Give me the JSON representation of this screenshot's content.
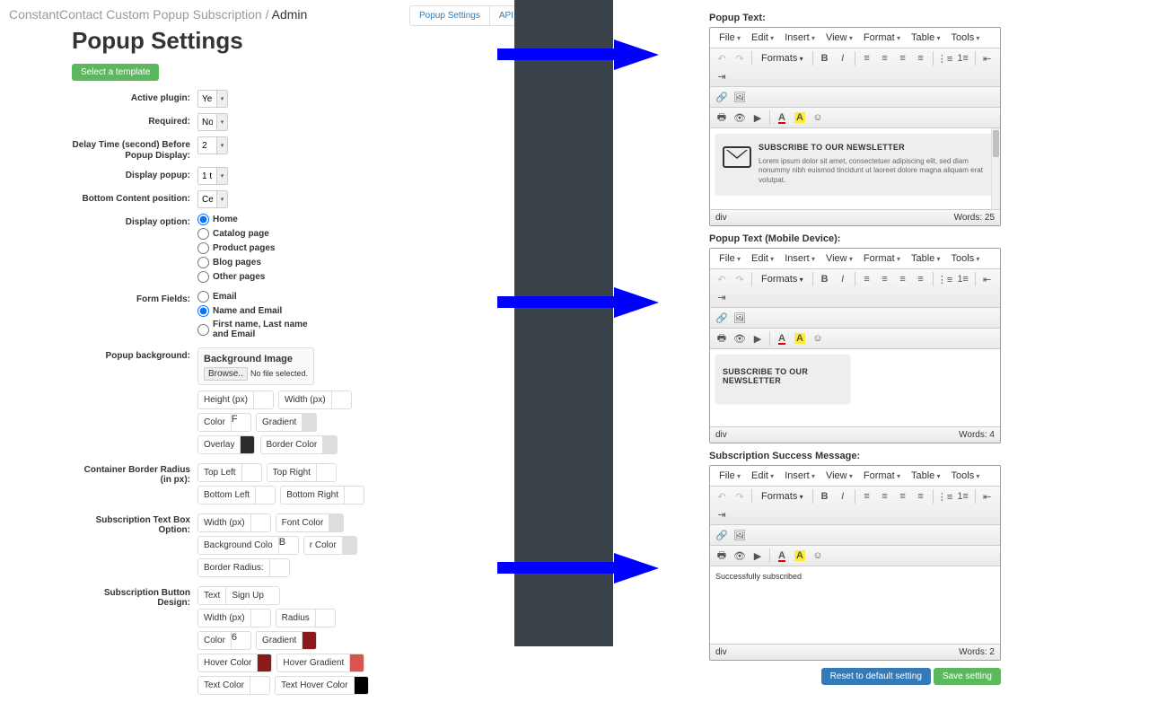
{
  "breadcrumb": {
    "app": "ConstantContact Custom Popup Subscription",
    "sep": " / ",
    "page": "Admin"
  },
  "tabs": {
    "popup": "Popup Settings",
    "api": "API Settings"
  },
  "title": "Popup Settings",
  "select_template": "Select a template",
  "form": {
    "active_plugin": {
      "label": "Active plugin:",
      "value": "Ye"
    },
    "required": {
      "label": "Required:",
      "value": "No"
    },
    "delay": {
      "label": "Delay Time (second) Before Popup Display:",
      "value": "2"
    },
    "display_popup": {
      "label": "Display popup:",
      "value": "1 t"
    },
    "bottom_content": {
      "label": "Bottom Content position:",
      "value": "Ce"
    },
    "display_option": {
      "label": "Display option:",
      "items": [
        "Home",
        "Catalog page",
        "Product pages",
        "Blog pages",
        "Other pages"
      ],
      "selected": 0
    },
    "form_fields": {
      "label": "Form Fields:",
      "items": [
        "Email",
        "Name and Email",
        "First name, Last name and Email"
      ],
      "selected": 1
    },
    "popup_bg": {
      "label": "Popup background:",
      "panel_title": "Background Image",
      "browse": "Browse..",
      "no_file": "No file selected.",
      "height": "Height (px)",
      "width": "Width (px)",
      "color": "Color",
      "color_v": "F",
      "gradient": "Gradient",
      "overlay": "Overlay",
      "border_color": "Border Color"
    },
    "border_radius": {
      "label": "Container Border Radius (in px):",
      "tl": "Top Left",
      "tr": "Top Right",
      "bl": "Bottom Left",
      "br": "Bottom Right"
    },
    "textbox": {
      "label": "Subscription Text Box Option:",
      "width": "Width (px)",
      "font_color": "Font Color",
      "bg": "Background Colo",
      "bg_v": "B",
      "bc": "r Color",
      "br": "Border Radius:"
    },
    "button": {
      "label": "Subscription Button Design:",
      "text": "Text",
      "text_v": "Sign Up",
      "width": "Width (px)",
      "radius": "Radius",
      "color": "Color",
      "color_v": "6",
      "gradient": "Gradient",
      "hover": "Hover Color",
      "hover_g": "Hover Gradient",
      "tc": "Text Color",
      "thc": "Text Hover Color"
    }
  },
  "editors": {
    "menu": {
      "file": "File",
      "edit": "Edit",
      "insert": "Insert",
      "view": "View",
      "format": "Format",
      "table": "Table",
      "tools": "Tools"
    },
    "formats": "Formats",
    "e1": {
      "label": "Popup Text:",
      "title": "SUBSCRIBE TO OUR NEWSLETTER",
      "lorem": "Lorem ipsum dolor sit amet, consectetuer adipiscing elit, sed diam nonummy nibh euismod tincidunt ut laoreet dolore magna aliquam erat volutpat.",
      "path": "div",
      "words": "Words: 25"
    },
    "e2": {
      "label": "Popup Text (Mobile Device):",
      "title": "SUBSCRIBE TO OUR NEWSLETTER",
      "path": "div",
      "words": "Words: 4"
    },
    "e3": {
      "label": "Subscription Success Message:",
      "body": "Successfully subscribed",
      "path": "div",
      "words": "Words: 2"
    }
  },
  "footer": {
    "reset": "Reset to default setting",
    "save": "Save setting"
  }
}
